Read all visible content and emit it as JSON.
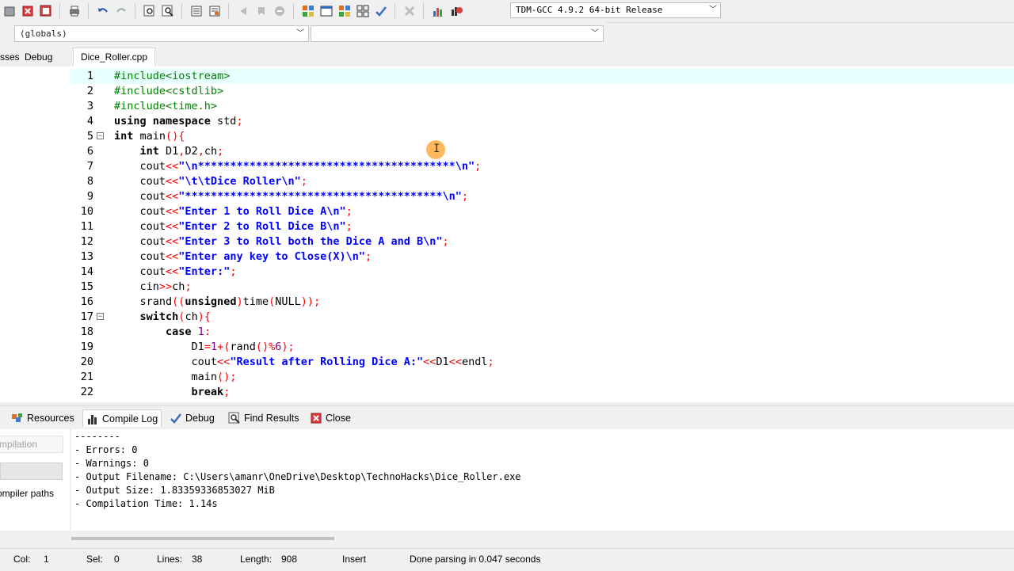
{
  "toolbar": {
    "compiler": "TDM-GCC 4.9.2 64-bit Release",
    "icons": [
      "new-icon",
      "close-file-icon",
      "close-all-icon",
      "print-icon",
      "undo-icon",
      "redo-icon",
      "find-icon",
      "replace-icon",
      "indent-icon",
      "unindent-icon",
      "bookmark-back-icon",
      "bookmark-fwd-icon",
      "goto-icon",
      "compile-icon",
      "run-icon",
      "compile-run-icon",
      "rebuild-icon",
      "syntax-check-icon",
      "stop-icon",
      "chart-icon",
      "debug-icon"
    ]
  },
  "toolbar2": {
    "scope": "(globals)",
    "function": ""
  },
  "left_tabs": {
    "classes": "sses",
    "debug": "Debug"
  },
  "file_tab": "Dice_Roller.cpp",
  "editor": {
    "lines": [
      [
        [
          "pre",
          "#include<iostream>"
        ]
      ],
      [
        [
          "pre",
          "#include<cstdlib>"
        ]
      ],
      [
        [
          "pre",
          "#include<time.h>"
        ]
      ],
      [
        [
          "kw",
          "using namespace "
        ],
        [
          "id",
          "std"
        ],
        [
          "sym",
          ";"
        ]
      ],
      [
        [
          "kw",
          "int "
        ],
        [
          "id",
          "main"
        ],
        [
          "sym",
          "(){"
        ]
      ],
      [
        [
          "id",
          "    "
        ],
        [
          "kw",
          "int "
        ],
        [
          "id",
          "D1"
        ],
        [
          "sym",
          ","
        ],
        [
          "id",
          "D2"
        ],
        [
          "sym",
          ","
        ],
        [
          "id",
          "ch"
        ],
        [
          "sym",
          ";"
        ]
      ],
      [
        [
          "id",
          "    cout"
        ],
        [
          "sym",
          "<<"
        ],
        [
          "str",
          "\"\\n****************************************\\n\""
        ],
        [
          "sym",
          ";"
        ]
      ],
      [
        [
          "id",
          "    cout"
        ],
        [
          "sym",
          "<<"
        ],
        [
          "str",
          "\"\\t\\tDice Roller\\n\""
        ],
        [
          "sym",
          ";"
        ]
      ],
      [
        [
          "id",
          "    cout"
        ],
        [
          "sym",
          "<<"
        ],
        [
          "str",
          "\"****************************************\\n\""
        ],
        [
          "sym",
          ";"
        ]
      ],
      [
        [
          "id",
          "    cout"
        ],
        [
          "sym",
          "<<"
        ],
        [
          "str",
          "\"Enter 1 to Roll Dice A\\n\""
        ],
        [
          "sym",
          ";"
        ]
      ],
      [
        [
          "id",
          "    cout"
        ],
        [
          "sym",
          "<<"
        ],
        [
          "str",
          "\"Enter 2 to Roll Dice B\\n\""
        ],
        [
          "sym",
          ";"
        ]
      ],
      [
        [
          "id",
          "    cout"
        ],
        [
          "sym",
          "<<"
        ],
        [
          "str",
          "\"Enter 3 to Roll both the Dice A and B\\n\""
        ],
        [
          "sym",
          ";"
        ]
      ],
      [
        [
          "id",
          "    cout"
        ],
        [
          "sym",
          "<<"
        ],
        [
          "str",
          "\"Enter any key to Close(X)\\n\""
        ],
        [
          "sym",
          ";"
        ]
      ],
      [
        [
          "id",
          "    cout"
        ],
        [
          "sym",
          "<<"
        ],
        [
          "str",
          "\"Enter:\""
        ],
        [
          "sym",
          ";"
        ]
      ],
      [
        [
          "id",
          "    cin"
        ],
        [
          "sym",
          ">>"
        ],
        [
          "id",
          "ch"
        ],
        [
          "sym",
          ";"
        ]
      ],
      [
        [
          "id",
          "    srand"
        ],
        [
          "sym",
          "(("
        ],
        [
          "kw",
          "unsigned"
        ],
        [
          "sym",
          ")"
        ],
        [
          "id",
          "time"
        ],
        [
          "sym",
          "("
        ],
        [
          "id",
          "NULL"
        ],
        [
          "sym",
          "));"
        ]
      ],
      [
        [
          "id",
          "    "
        ],
        [
          "kw",
          "switch"
        ],
        [
          "sym",
          "("
        ],
        [
          "id",
          "ch"
        ],
        [
          "sym",
          "){"
        ]
      ],
      [
        [
          "id",
          "        "
        ],
        [
          "kw",
          "case "
        ],
        [
          "num",
          "1"
        ],
        [
          "sym",
          ":"
        ]
      ],
      [
        [
          "id",
          "            D1"
        ],
        [
          "sym",
          "="
        ],
        [
          "num",
          "1"
        ],
        [
          "sym",
          "+("
        ],
        [
          "id",
          "rand"
        ],
        [
          "sym",
          "()%"
        ],
        [
          "num",
          "6"
        ],
        [
          "sym",
          ");"
        ]
      ],
      [
        [
          "id",
          "            cout"
        ],
        [
          "sym",
          "<<"
        ],
        [
          "str",
          "\"Result after Rolling Dice A:\""
        ],
        [
          "sym",
          "<<"
        ],
        [
          "id",
          "D1"
        ],
        [
          "sym",
          "<<"
        ],
        [
          "id",
          "endl"
        ],
        [
          "sym",
          ";"
        ]
      ],
      [
        [
          "id",
          "            main"
        ],
        [
          "sym",
          "();"
        ]
      ],
      [
        [
          "id",
          "            "
        ],
        [
          "kw",
          "break"
        ],
        [
          "sym",
          ";"
        ]
      ]
    ],
    "line_numbers": [
      "1",
      "2",
      "3",
      "4",
      "5",
      "6",
      "7",
      "8",
      "9",
      "10",
      "11",
      "12",
      "13",
      "14",
      "15",
      "16",
      "17",
      "18",
      "19",
      "20",
      "21",
      "22"
    ]
  },
  "bottom_tabs": {
    "resources": "Resources",
    "compile_log": "Compile Log",
    "debug": "Debug",
    "find_results": "Find Results",
    "close": "Close"
  },
  "log_panel": {
    "abort": "mpilation",
    "shorten": "ompiler paths",
    "lines": [
      "--------",
      "- Errors: 0",
      "- Warnings: 0",
      "- Output Filename: C:\\Users\\amanr\\OneDrive\\Desktop\\TechnoHacks\\Dice_Roller.exe",
      "- Output Size: 1.83359336853027 MiB",
      "- Compilation Time: 1.14s"
    ]
  },
  "status": {
    "col_label": "Col:",
    "col": "1",
    "sel_label": "Sel:",
    "sel": "0",
    "lines_label": "Lines:",
    "lines": "38",
    "length_label": "Length:",
    "length": "908",
    "mode": "Insert",
    "message": "Done parsing in 0.047 seconds"
  },
  "colors": {
    "preprocessor": "#008000",
    "string": "#0000ff",
    "symbol": "#ff0000",
    "number": "#800080",
    "current_line": "#e8ffff"
  }
}
